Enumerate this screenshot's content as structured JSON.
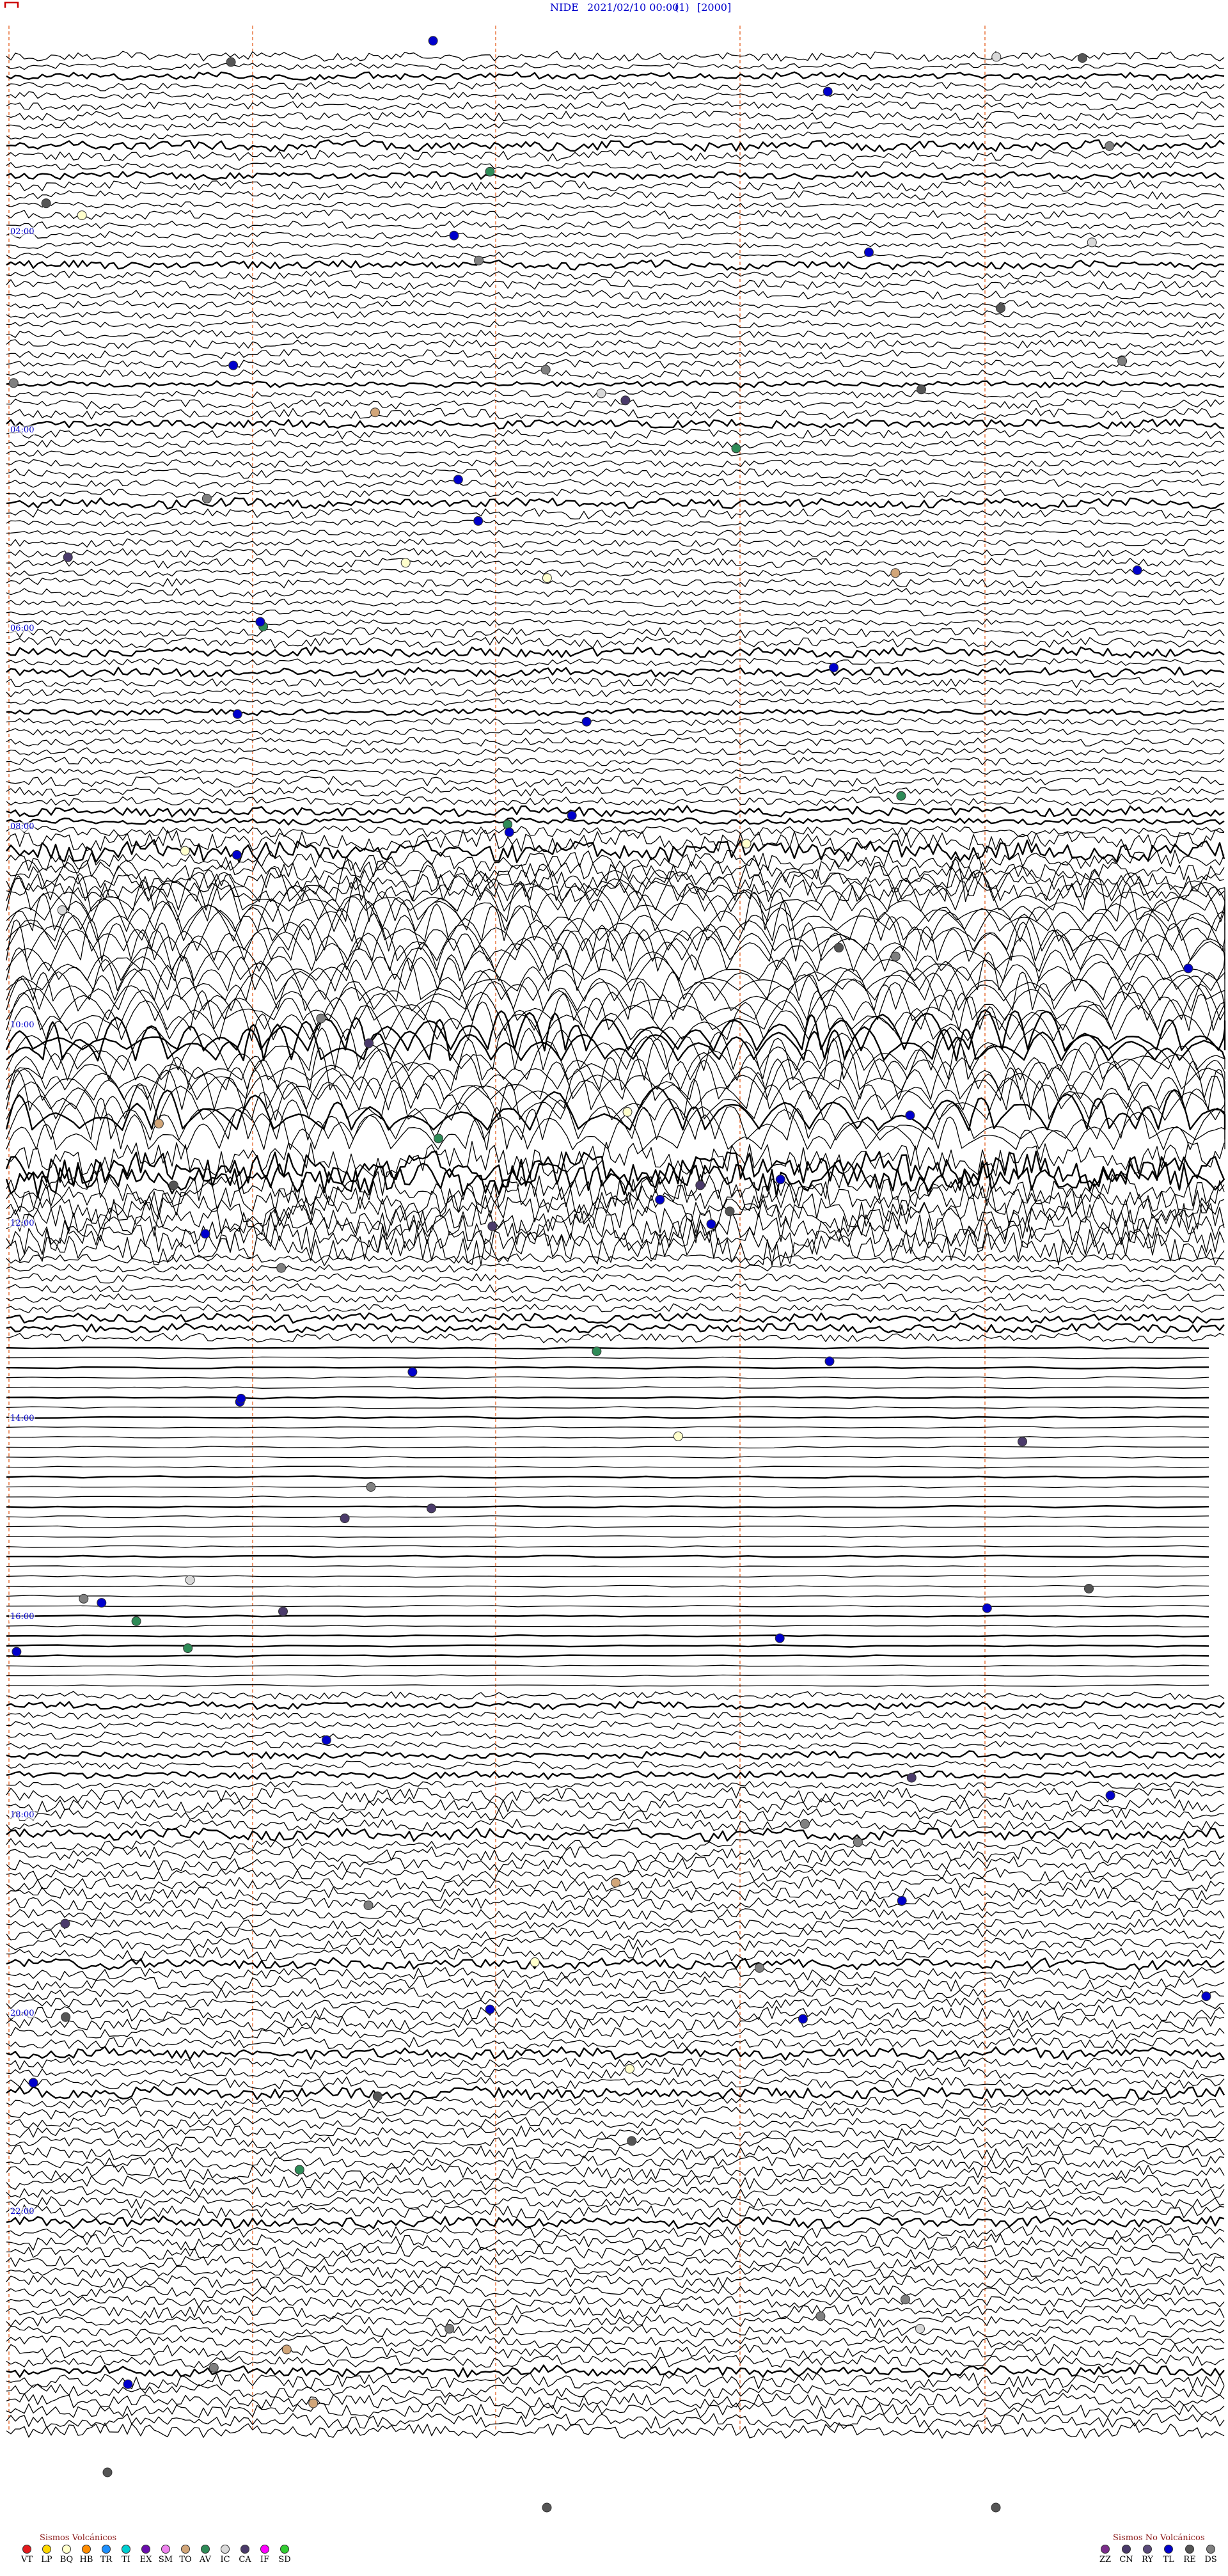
{
  "header": {
    "station": "NIDE",
    "datetime": "2021/02/10 00:00",
    "component": "(1)",
    "scale": "[2000]"
  },
  "time_labels": [
    "02:00",
    "04:00",
    "06:00",
    "08:00",
    "10:00",
    "12:00",
    "14:00",
    "16:00",
    "18:00",
    "20:00",
    "22:00"
  ],
  "legend": {
    "volcanic_title": "Sismos Volcánicos",
    "volcanic": [
      {
        "code": "VT",
        "color": "#e31a1c"
      },
      {
        "code": "LP",
        "color": "#ffd700"
      },
      {
        "code": "BQ",
        "color": "#ffffcc"
      },
      {
        "code": "HB",
        "color": "#ff8c00"
      },
      {
        "code": "TR",
        "color": "#1e90ff"
      },
      {
        "code": "TI",
        "color": "#00ced1"
      },
      {
        "code": "EX",
        "color": "#6a0dad"
      },
      {
        "code": "SM",
        "color": "#ee82ee"
      },
      {
        "code": "TO",
        "color": "#d2a679"
      },
      {
        "code": "AV",
        "color": "#2e8b57"
      },
      {
        "code": "IC",
        "color": "#d9d9d9"
      },
      {
        "code": "CA",
        "color": "#4b3b6b"
      },
      {
        "code": "IF",
        "color": "#ff00ff"
      },
      {
        "code": "SD",
        "color": "#32cd32"
      }
    ],
    "novolcanic_title": "Sismos No Volcánicos",
    "novolcanic": [
      {
        "code": "ZZ",
        "color": "#7b2d8b"
      },
      {
        "code": "CN",
        "color": "#4b3b6b"
      },
      {
        "code": "RY",
        "color": "#5a4a7a"
      },
      {
        "code": "TL",
        "color": "#0000cc"
      },
      {
        "code": "RE",
        "color": "#555555"
      },
      {
        "code": "DS",
        "color": "#808080"
      }
    ]
  },
  "colors": {
    "trace": "#000000",
    "minute_marker": "#e8743b",
    "time_label": "#0000cc",
    "legend_title": "#8b1a1a"
  }
}
